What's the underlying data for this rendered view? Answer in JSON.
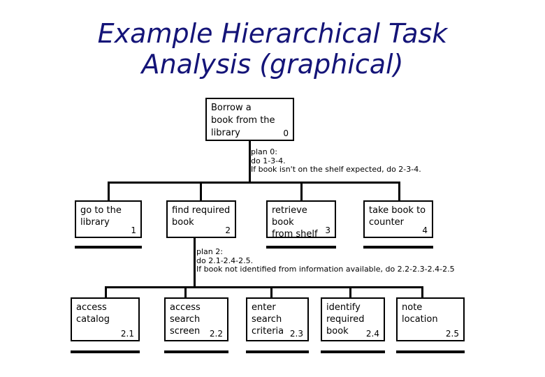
{
  "title": {
    "line1": "Example Hierarchical Task",
    "line2": "Analysis (graphical)",
    "color": "#141478"
  },
  "diagram": {
    "type": "hierarchical-task-analysis",
    "root": {
      "label": "Borrow a book from the library",
      "label_lines": [
        "Borrow a",
        "book from the",
        "library"
      ],
      "number": "0"
    },
    "plans": [
      {
        "id": "plan-0",
        "lines": [
          "plan 0:",
          "do 1-3-4.",
          "If book isn't on the shelf expected, do 2-3-4."
        ]
      },
      {
        "id": "plan-2",
        "lines": [
          "plan 2:",
          "do 2.1-2.4-2.5.",
          "If book not identified from information available, do 2.2-2.3-2.4-2.5"
        ]
      }
    ],
    "level1": [
      {
        "label": "go to the library",
        "label_lines": [
          "go to the",
          "library"
        ],
        "number": "1",
        "terminal": true
      },
      {
        "label": "find required book",
        "label_lines": [
          "find required",
          "book"
        ],
        "number": "2",
        "terminal": false
      },
      {
        "label": "retrieve book from shelf",
        "label_lines": [
          "retrieve book",
          "from shelf"
        ],
        "number": "3",
        "terminal": true
      },
      {
        "label": "take book to counter",
        "label_lines": [
          "take book to",
          "counter"
        ],
        "number": "4",
        "terminal": true
      }
    ],
    "level2": [
      {
        "label": "access catalog",
        "label_lines": [
          "access",
          "catalog"
        ],
        "number": "2.1",
        "terminal": true
      },
      {
        "label": "access search screen",
        "label_lines": [
          "access",
          "search",
          "screen"
        ],
        "number": "2.2",
        "terminal": true
      },
      {
        "label": "enter search criteria",
        "label_lines": [
          "enter",
          "search",
          "criteria"
        ],
        "number": "2.3",
        "terminal": true
      },
      {
        "label": "identify required book",
        "label_lines": [
          "identify",
          "required",
          "book"
        ],
        "number": "2.4",
        "terminal": true
      },
      {
        "label": "note location",
        "label_lines": [
          "note",
          "location"
        ],
        "number": "2.5",
        "terminal": true
      }
    ]
  }
}
